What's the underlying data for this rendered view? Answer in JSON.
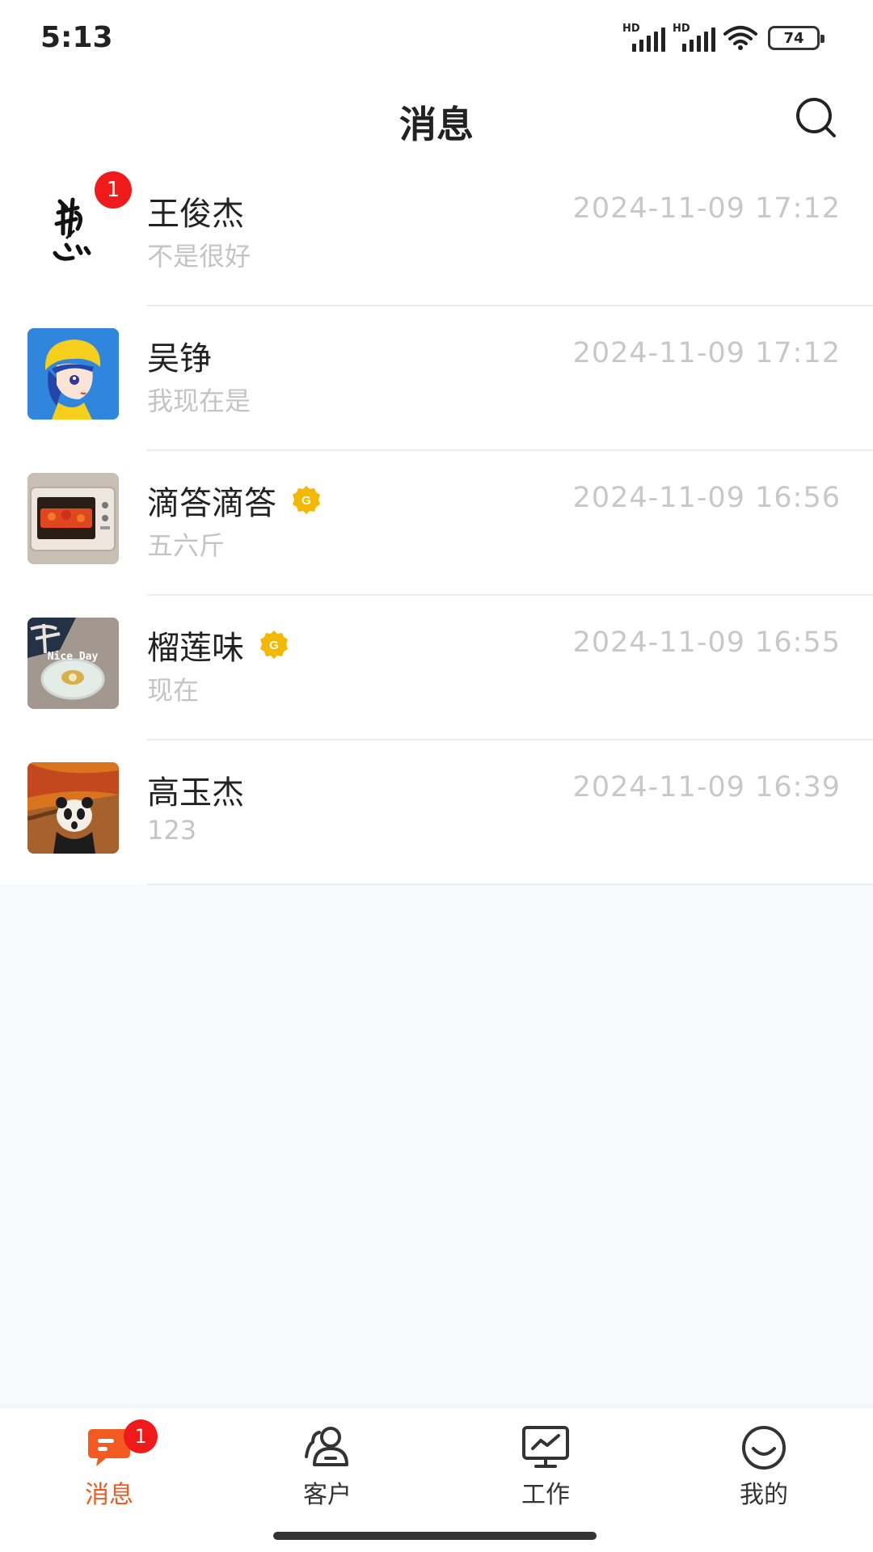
{
  "status_bar": {
    "time": "5:13",
    "signal_labels": [
      "HD",
      "HD"
    ],
    "battery": "74"
  },
  "header": {
    "title": "消息",
    "search_icon": "search-icon"
  },
  "conversations": [
    {
      "name": "王俊杰",
      "preview": "不是很好",
      "time": "2024-11-09 17:12",
      "badge": "1",
      "vip": false,
      "avatar": "calligraphy-avatar"
    },
    {
      "name": "吴铮",
      "preview": "我现在是",
      "time": "2024-11-09 17:12",
      "vip": false,
      "avatar": "anime-girl-avatar"
    },
    {
      "name": "滴答滴答",
      "preview": "五六斤",
      "time": "2024-11-09 16:56",
      "vip": true,
      "vip_letter": "G",
      "avatar": "oven-avatar"
    },
    {
      "name": "榴莲味",
      "preview": "现在",
      "time": "2024-11-09 16:55",
      "vip": true,
      "vip_letter": "G",
      "avatar": "nice-day-photo-avatar",
      "avatar_text": "Nice Day"
    },
    {
      "name": "高玉杰",
      "preview": "123",
      "time": "2024-11-09 16:39",
      "vip": false,
      "avatar": "scream-panda-avatar"
    }
  ],
  "tab_bar": {
    "tabs": [
      {
        "label": "消息",
        "icon": "chat-bubble-icon",
        "active": true,
        "badge": "1"
      },
      {
        "label": "客户",
        "icon": "customers-icon",
        "active": false
      },
      {
        "label": "工作",
        "icon": "monitor-chart-icon",
        "active": false
      },
      {
        "label": "我的",
        "icon": "smiley-icon",
        "active": false
      }
    ]
  },
  "colors": {
    "accent": "#f25a21",
    "badge": "#f11a1a",
    "vip": "#f5b800",
    "background": "#f7f9fc"
  }
}
